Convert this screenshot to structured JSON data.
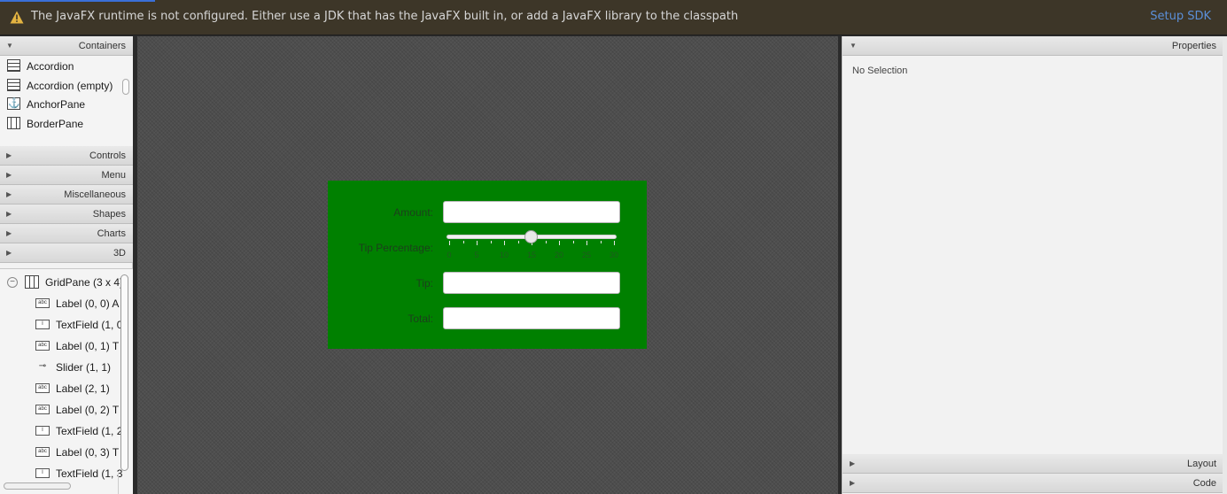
{
  "banner": {
    "message": "The JavaFX runtime is not configured. Either use a JDK that has the JavaFX built in, or add a JavaFX library to the classpath",
    "action": "Setup SDK"
  },
  "library": {
    "containers_header": "Containers",
    "containers": [
      "Accordion",
      "Accordion  (empty)",
      "AnchorPane",
      "BorderPane"
    ],
    "sections": [
      "Controls",
      "Menu",
      "Miscellaneous",
      "Shapes",
      "Charts",
      "3D"
    ]
  },
  "hierarchy": {
    "root": "GridPane (3 x 4)",
    "items": [
      {
        "icon": "label-icon",
        "text": "Label (0, 0)  A"
      },
      {
        "icon": "textfield-icon",
        "text": "TextField (1, 0"
      },
      {
        "icon": "label-icon",
        "text": "Label (0, 1)  T"
      },
      {
        "icon": "slider-icon",
        "text": "Slider (1, 1)"
      },
      {
        "icon": "label-icon",
        "text": "Label (2, 1)"
      },
      {
        "icon": "label-icon",
        "text": "Label (0, 2)  T"
      },
      {
        "icon": "textfield-icon",
        "text": "TextField (1, 2"
      },
      {
        "icon": "label-icon",
        "text": "Label (0, 3)  T"
      },
      {
        "icon": "textfield-icon",
        "text": "TextField (1, 3"
      }
    ]
  },
  "form": {
    "amount_label": "Amount:",
    "tip_percentage_label": "Tip Percentage:",
    "tip_label": "Tip:",
    "total_label": "Total:",
    "amount_value": "",
    "tip_value": "",
    "total_value": "",
    "slider_value": 15,
    "slider_min": 0,
    "slider_max": 30,
    "slider_ticks": [
      "0",
      "5",
      "10",
      "15",
      "20",
      "25",
      "30"
    ]
  },
  "properties": {
    "header": "Properties",
    "empty_text": "No Selection",
    "layout_header": "Layout",
    "code_header": "Code"
  },
  "colors": {
    "gridpane_background": "#008000",
    "banner_background": "#3d3628",
    "link": "#5b8fd8"
  }
}
